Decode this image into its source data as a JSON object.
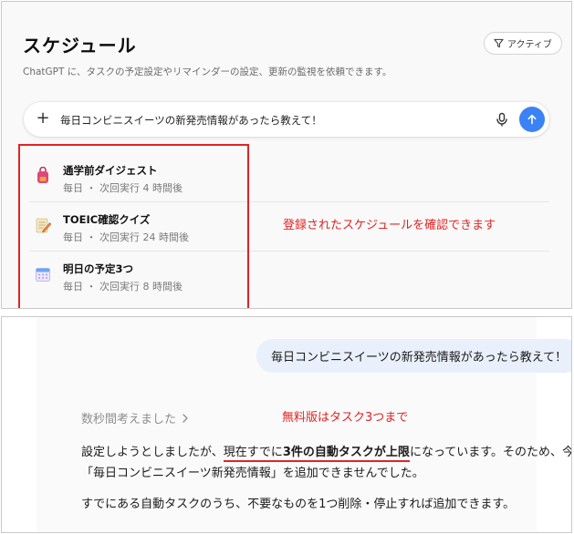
{
  "schedule_panel": {
    "title": "スケジュール",
    "filter_label": "アクティブ",
    "subtitle": "ChatGPT に、タスクの予定設定やリマインダーの設定、更新の監視を依頼できます。",
    "composer": {
      "value": "毎日コンビニスイーツの新発売情報があったら教えて！",
      "icons": [
        "plus-icon",
        "microphone-icon",
        "send-arrow-icon"
      ]
    },
    "items": [
      {
        "name": "通学前ダイジェスト",
        "meta": "毎日 ・ 次回実行 4 時間後",
        "icon": "backpack-icon"
      },
      {
        "name": "TOEIC確認クイズ",
        "meta": "毎日 ・ 次回実行 24 時間後",
        "icon": "memo-pencil-icon"
      },
      {
        "name": "明日の予定3つ",
        "meta": "毎日 ・ 次回実行 8 時間後",
        "icon": "calendar-icon"
      }
    ],
    "annotation": "登録されたスケジュールを確認できます",
    "annotation_color": "#e02424"
  },
  "chat_panel": {
    "user_message": "毎日コンビニスイーツの新発売情報があったら教えて！",
    "thought_label": "数秒間考えました",
    "annotation": "無料版はタスク3つまで",
    "reply": {
      "line1_a": "設定しようとしましたが、",
      "line1_b": "現在すでに",
      "line1_c": "3件の自動タスクが上限",
      "line1_d": "になっています。そのため、今回の",
      "line2": "「毎日コンビニスイーツ新発売情報」を追加できませんでした。",
      "line3": "すでにある自動タスクのうち、不要なものを1つ削除・停止すれば追加できます。"
    },
    "colors": {
      "bubble": "#e9f0fb",
      "send_button": "#3b82f6"
    }
  }
}
